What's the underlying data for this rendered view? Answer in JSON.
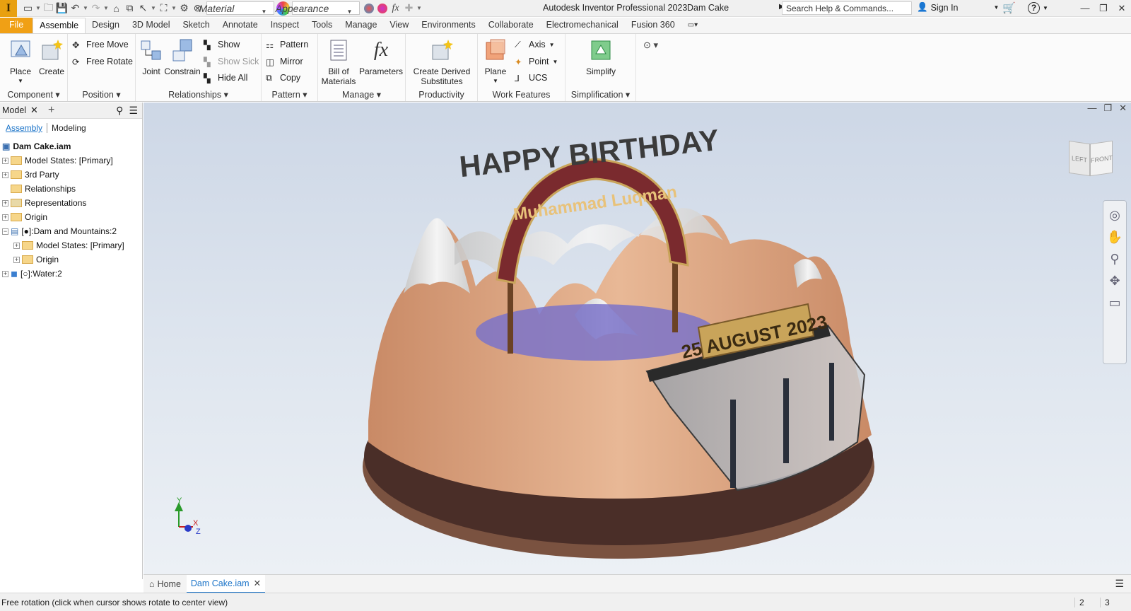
{
  "title_bar": {
    "logo_letter": "I",
    "material_placeholder": "Material",
    "appearance_placeholder": "Appearance",
    "app_title": "Autodesk Inventor Professional 2023",
    "document_name": "Dam Cake",
    "search_placeholder": "Search Help & Commands...",
    "sign_in": "Sign In",
    "help": "?"
  },
  "ribbon_tabs": [
    "File",
    "Assemble",
    "Design",
    "3D Model",
    "Sketch",
    "Annotate",
    "Inspect",
    "Tools",
    "Manage",
    "View",
    "Environments",
    "Collaborate",
    "Electromechanical",
    "Fusion 360"
  ],
  "active_tab": "Assemble",
  "ribbon": {
    "component": {
      "label": "Component",
      "place": "Place",
      "create": "Create"
    },
    "position": {
      "label": "Position",
      "free_move": "Free Move",
      "free_rotate": "Free Rotate"
    },
    "relationships": {
      "label": "Relationships",
      "joint": "Joint",
      "constrain": "Constrain",
      "show": "Show",
      "show_sick": "Show Sick",
      "hide_all": "Hide All"
    },
    "pattern": {
      "label": "Pattern",
      "pattern": "Pattern",
      "mirror": "Mirror",
      "copy": "Copy"
    },
    "manage": {
      "label": "Manage",
      "bom_line1": "Bill of",
      "bom_line2": "Materials",
      "parameters": "Parameters"
    },
    "productivity": {
      "label": "Productivity",
      "derived_line1": "Create Derived",
      "derived_line2": "Substitutes"
    },
    "work_features": {
      "label": "Work Features",
      "plane": "Plane",
      "axis": "Axis",
      "point": "Point",
      "ucs": "UCS"
    },
    "simplification": {
      "label": "Simplification",
      "simplify": "Simplify"
    }
  },
  "browser": {
    "tab_label": "Model",
    "mode_assembly": "Assembly",
    "mode_modeling": "Modeling",
    "root": "Dam Cake.iam",
    "nodes": [
      {
        "label": "Model States: [Primary]"
      },
      {
        "label": "3rd Party"
      },
      {
        "label": "Relationships"
      },
      {
        "label": "Representations"
      },
      {
        "label": "Origin"
      },
      {
        "label": "[●]:Dam and Mountains:2"
      },
      {
        "label": "Model States: [Primary]"
      },
      {
        "label": "Origin"
      },
      {
        "label": "[○]:Water:2"
      }
    ]
  },
  "viewcube": {
    "left": "LEFT",
    "front": "FRONT"
  },
  "model_text": {
    "happy_birthday": "HAPPY BIRTHDAY",
    "name": "Muhammad Luqman",
    "date": "25 AUGUST 2023"
  },
  "axes": {
    "x": "X",
    "y": "Y",
    "z": "Z"
  },
  "doc_tabs": {
    "home": "Home",
    "active": "Dam Cake.iam"
  },
  "status": {
    "message": "Free rotation (click when cursor shows rotate to center view)",
    "count1": "2",
    "count2": "3"
  },
  "colors": {
    "file_tab": "#f0a015",
    "accent": "#1a73c8",
    "cake_body": "#d9a07e",
    "cake_base": "#4a2e28",
    "water": "#7b73c9",
    "banner": "#7a2a2e"
  }
}
